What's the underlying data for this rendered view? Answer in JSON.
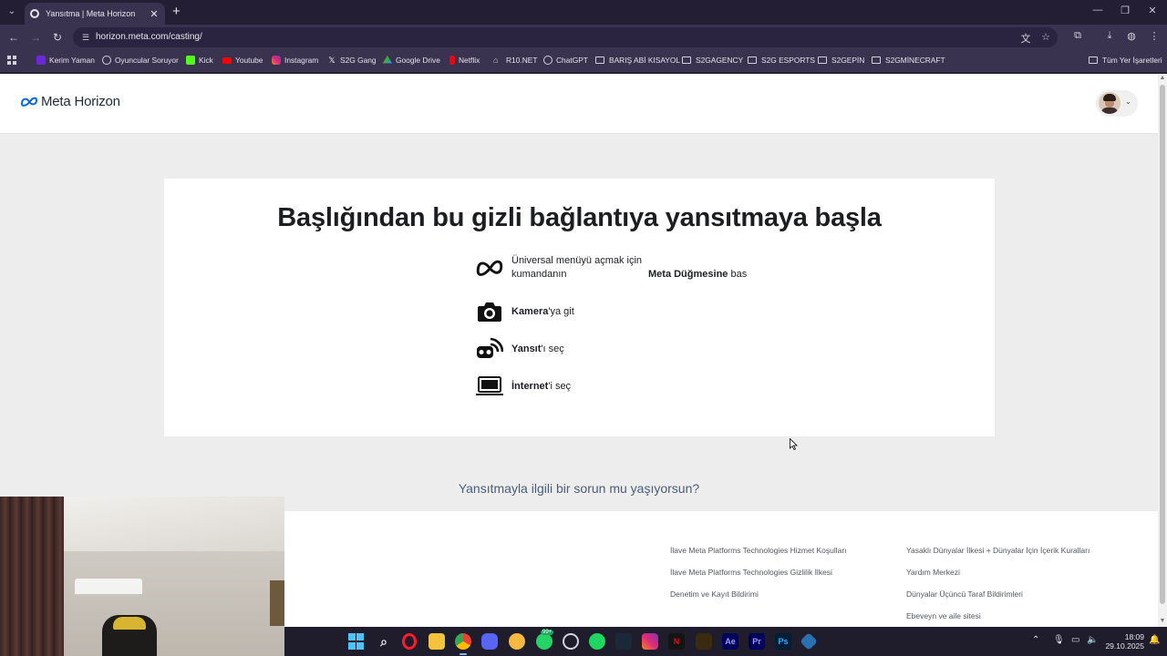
{
  "browser": {
    "tab_title": "Yansıtma | Meta Horizon",
    "url": "horizon.meta.com/casting/",
    "bookmarks": [
      {
        "label": "Kerim Yaman",
        "color": "#6a2bd6"
      },
      {
        "label": "Oyuncular Soruyor",
        "color": "#d4d0de"
      },
      {
        "label": "Kick",
        "color": "#53fc18"
      },
      {
        "label": "Youtube",
        "color": "#ff0000"
      },
      {
        "label": "Instagram",
        "color": "#e1306c"
      },
      {
        "label": "S2G Gang",
        "color": "#ffffff"
      },
      {
        "label": "Google Drive",
        "color": "#34a853"
      },
      {
        "label": "Netflix",
        "color": "#e50914"
      },
      {
        "label": "R10.NET",
        "color": "#d4d0de"
      },
      {
        "label": "ChatGPT",
        "color": "#d4d0de"
      }
    ],
    "bookmark_folders": [
      "BARIŞ ABİ KISAYOL",
      "S2GAGENCY",
      "S2G ESPORTS",
      "S2GEPİN",
      "S2GMİNECRAFT"
    ],
    "all_bookmarks": "Tüm Yer İşaretleri"
  },
  "site": {
    "logo_text": "Meta Horizon",
    "brand_color": "#0668e1"
  },
  "card": {
    "headline": "Başlığından bu gizli bağlantıya yansıtmaya başla",
    "steps": [
      {
        "icon": "meta-logo-icon",
        "pre": "",
        "bold_1": "",
        "mid": "Üniversal menüyü açmak için kumandanın ",
        "bold_2": "Meta Düğmesine",
        "post": " bas"
      },
      {
        "icon": "camera-icon",
        "bold": "Kamera",
        "post": "'ya git"
      },
      {
        "icon": "cast-icon",
        "bold": "Yansıt",
        "post": "'ı seç"
      },
      {
        "icon": "computer-icon",
        "bold": "İnternet",
        "post": "'i seç"
      }
    ]
  },
  "help_link": "Yansıtmayla ilgili bir sorun mu yaşıyorsun?",
  "footer": {
    "col1": [
      "İlave Meta Platforms Technologies Hizmet Koşulları",
      "İlave Meta Platforms Technologies Gizlilik İlkesi",
      "Denetim ve Kayıt Bildirimi"
    ],
    "col2": [
      "Yasaklı Dünyalar İlkesi + Dünyalar İçin İçerik Kuralları",
      "Yardım Merkezi",
      "Dünyalar Üçüncü Taraf Bildirimleri",
      "Ebeveyn ve aile sitesi"
    ]
  },
  "taskbar": {
    "time": "18:09",
    "date": "29.10.2025",
    "badge": "99+"
  }
}
